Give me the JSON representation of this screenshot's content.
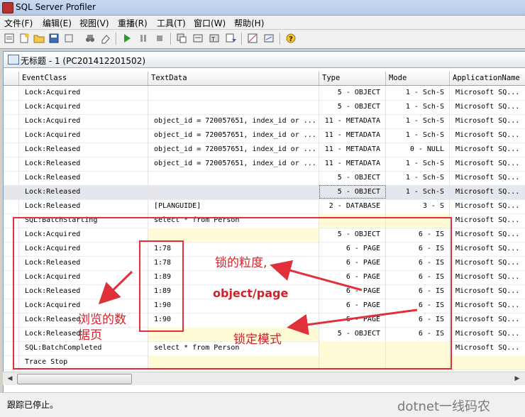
{
  "app": {
    "title": "SQL Server Profiler"
  },
  "menu": [
    "文件(F)",
    "编辑(E)",
    "视图(V)",
    "重播(R)",
    "工具(T)",
    "窗口(W)",
    "帮助(H)"
  ],
  "trace": {
    "title": "无标题 - 1 (PC201412201502)"
  },
  "columns": [
    "EventClass",
    "TextData",
    "Type",
    "Mode",
    "ApplicationName"
  ],
  "rows": [
    [
      "Lock:Acquired",
      "",
      "5 - OBJECT",
      "1 - Sch-S",
      "Microsoft SQ..."
    ],
    [
      "Lock:Acquired",
      "",
      "5 - OBJECT",
      "1 - Sch-S",
      "Microsoft SQ..."
    ],
    [
      "Lock:Acquired",
      "object_id = 720057651, index_id or ...",
      "11 - METADATA",
      "1 - Sch-S",
      "Microsoft SQ..."
    ],
    [
      "Lock:Acquired",
      "object_id = 720057651, index_id or ...",
      "11 - METADATA",
      "1 - Sch-S",
      "Microsoft SQ..."
    ],
    [
      "Lock:Released",
      "object_id = 720057651, index_id or ...",
      "11 - METADATA",
      "0 - NULL",
      "Microsoft SQ..."
    ],
    [
      "Lock:Released",
      "object_id = 720057651, index_id or ...",
      "11 - METADATA",
      "1 - Sch-S",
      "Microsoft SQ..."
    ],
    [
      "Lock:Released",
      "",
      "5 - OBJECT",
      "1 - Sch-S",
      "Microsoft SQ..."
    ],
    [
      "Lock:Released",
      "",
      "5 - OBJECT",
      "1 - Sch-S",
      "Microsoft SQ..."
    ],
    [
      "Lock:Released",
      "[PLANGUIDE]",
      "2 - DATABASE",
      "3 - S",
      "Microsoft SQ..."
    ],
    [
      "SQL:BatchStarting",
      "select * from Person",
      "",
      "",
      "Microsoft SQ..."
    ],
    [
      "Lock:Acquired",
      "",
      "5 - OBJECT",
      "6 - IS",
      "Microsoft SQ..."
    ],
    [
      "Lock:Acquired",
      "1:78",
      "6 - PAGE",
      "6 - IS",
      "Microsoft SQ..."
    ],
    [
      "Lock:Released",
      "1:78",
      "6 - PAGE",
      "6 - IS",
      "Microsoft SQ..."
    ],
    [
      "Lock:Acquired",
      "1:89",
      "6 - PAGE",
      "6 - IS",
      "Microsoft SQ..."
    ],
    [
      "Lock:Released",
      "1:89",
      "6 - PAGE",
      "6 - IS",
      "Microsoft SQ..."
    ],
    [
      "Lock:Acquired",
      "1:90",
      "6 - PAGE",
      "6 - IS",
      "Microsoft SQ..."
    ],
    [
      "Lock:Released",
      "1:90",
      "6 - PAGE",
      "6 - IS",
      "Microsoft SQ..."
    ],
    [
      "Lock:Released",
      "",
      "5 - OBJECT",
      "6 - IS",
      "Microsoft SQ..."
    ],
    [
      "SQL:BatchCompleted",
      "select * from Person",
      "",
      "",
      "Microsoft SQ..."
    ],
    [
      "Trace Stop",
      "",
      "",
      "",
      ""
    ]
  ],
  "annotations": {
    "browsed_pages": "浏览的数",
    "browsed_pages_2": "据页",
    "granularity": "锁的粒度,",
    "granularity_values": "object/page",
    "lock_mode": "锁定模式"
  },
  "status": {
    "text": "跟踪已停止。"
  },
  "watermark": {
    "text": "dotnet一线码农"
  },
  "colors": {
    "highlight": "#e0303a",
    "selection": "#e4e7ec",
    "empty_cell": "#fffbd6"
  }
}
